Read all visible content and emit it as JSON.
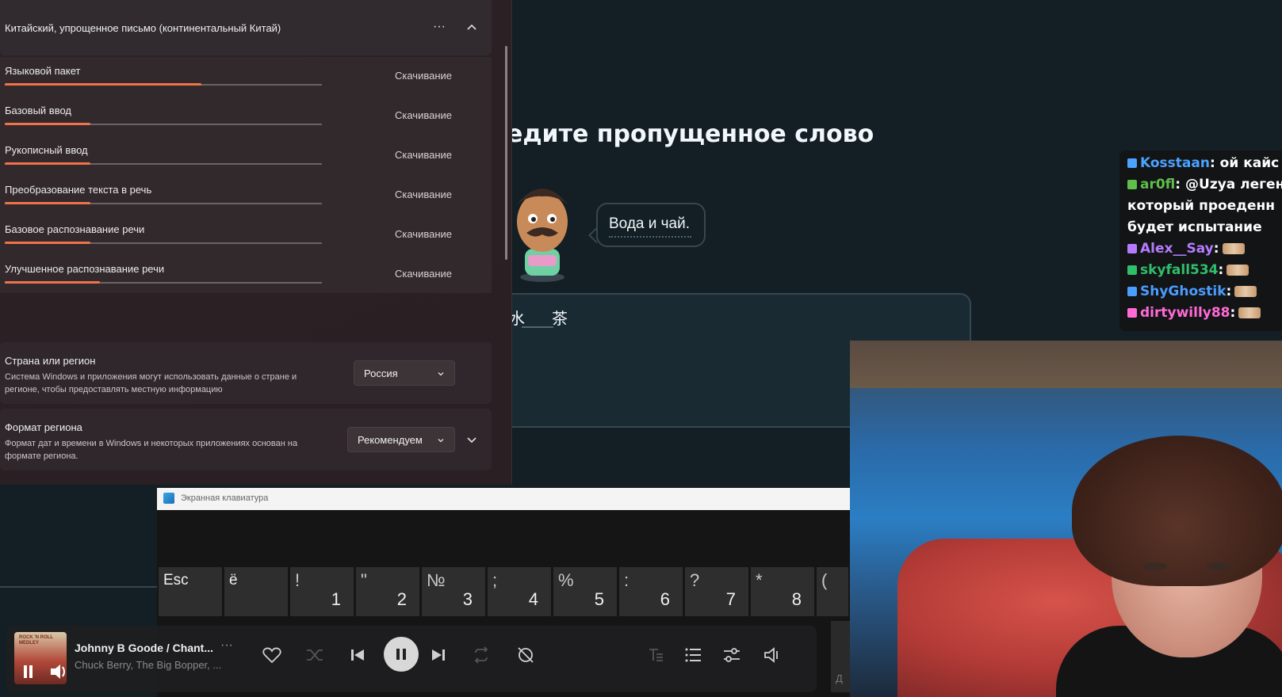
{
  "duolingo": {
    "title": "ведите пропущенное слово",
    "bubble_text": "Вода и чай.",
    "answer_words": [
      "水",
      "茶"
    ]
  },
  "settings": {
    "language_title": "Китайский, упрощенное письмо (континентальный Китай)",
    "features": [
      {
        "label": "Языковой пакет",
        "status": "Скачивание",
        "progress": 0.62
      },
      {
        "label": "Базовый ввод",
        "status": "Скачивание",
        "progress": 0.27
      },
      {
        "label": "Рукописный ввод",
        "status": "Скачивание",
        "progress": 0.27
      },
      {
        "label": "Преобразование текста в речь",
        "status": "Скачивание",
        "progress": 0.27
      },
      {
        "label": "Базовое распознавание речи",
        "status": "Скачивание",
        "progress": 0.27
      },
      {
        "label": "Улучшенное распознавание речи",
        "status": "Скачивание",
        "progress": 0.3
      }
    ],
    "region": {
      "title": "Страна или регион",
      "description": "Система Windows и приложения могут использовать данные о стране и регионе, чтобы предоставлять местную информацию",
      "value": "Россия"
    },
    "region_format": {
      "title": "Формат региона",
      "description": "Формат дат и времени в Windows и некоторых приложениях основан на формате региона.",
      "value": "Рекомендуем"
    },
    "accent_color": "#f0724a"
  },
  "osk": {
    "title": "Экранная клавиатура",
    "keys": [
      {
        "single": "Esc"
      },
      {
        "single": "ё"
      },
      {
        "top": "!",
        "main": "1"
      },
      {
        "top": "\"",
        "main": "2"
      },
      {
        "top": "№",
        "main": "3"
      },
      {
        "top": ";",
        "main": "4"
      },
      {
        "top": "%",
        "main": "5"
      },
      {
        "top": ":",
        "main": "6"
      },
      {
        "top": "?",
        "main": "7"
      },
      {
        "top": "*",
        "main": "8"
      },
      {
        "top": "(",
        "main": ""
      }
    ],
    "corner_key": "Д"
  },
  "player": {
    "album_text": "ROCK 'N ROLL MEDLEY",
    "title": "Johnny B Goode / Chant...",
    "artist": "Chuck Berry, The Big Bopper, ...",
    "more": "···",
    "icons": [
      "heart-icon",
      "shuffle-icon",
      "previous-icon",
      "pause-icon",
      "next-icon",
      "repeat-icon",
      "dislike-icon",
      "lyrics-icon",
      "queue-icon",
      "equalizer-icon",
      "volume-icon"
    ]
  },
  "chat": {
    "lines": [
      {
        "user": "Kosstaan",
        "text": ": ой кайс",
        "color": "#4aa3ff"
      },
      {
        "user": "ar0fl",
        "text": ": @Uzya легенд",
        "color": "#5fbf4a"
      },
      {
        "user": "",
        "text": "который проеденн",
        "color": "#ffffff"
      },
      {
        "user": "",
        "text": "будет испытание",
        "color": "#ffffff"
      },
      {
        "user": "Alex__Say",
        "text": ":",
        "color": "#b57bff"
      },
      {
        "user": "skyfall534",
        "text": ":",
        "color": "#2fbf6a"
      },
      {
        "user": "ShyGhostik",
        "text": ":",
        "color": "#4a9cff"
      },
      {
        "user": "dirtywilly88",
        "text": ":",
        "color": "#ff6ad5"
      }
    ]
  }
}
